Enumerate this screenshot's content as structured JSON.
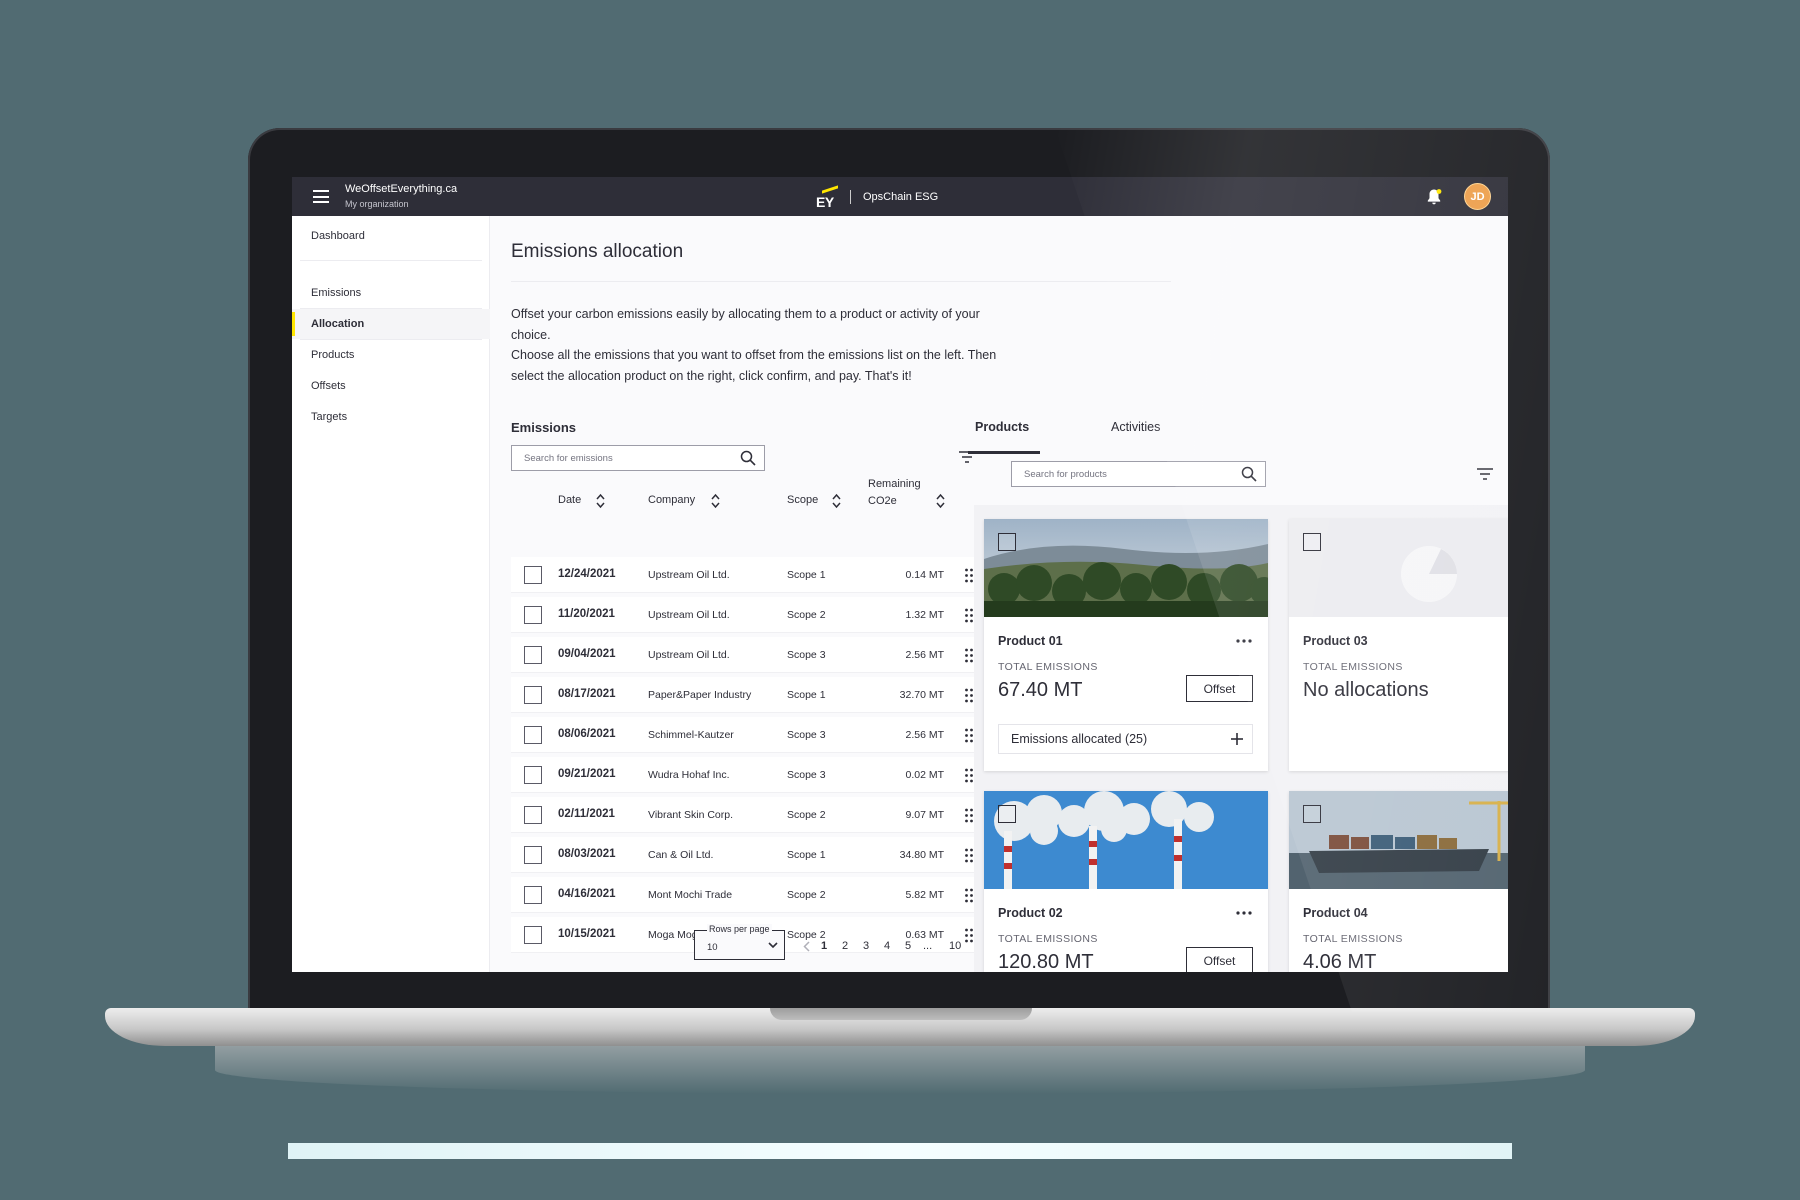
{
  "app": {
    "org_name": "WeOffsetEverything.ca",
    "org_sub": "My organization",
    "brand_logo": "EY",
    "product_name": "OpsChain ESG",
    "avatar_initials": "JD",
    "accent_color": "#ffe600",
    "topbar_color": "#2e2e38"
  },
  "sidebar": {
    "items": [
      {
        "label": "Dashboard",
        "active": false
      },
      {
        "label": "Emissions",
        "active": false
      },
      {
        "label": "Allocation",
        "active": true
      },
      {
        "label": "Products",
        "active": false
      },
      {
        "label": "Offsets",
        "active": false
      },
      {
        "label": "Targets",
        "active": false
      }
    ]
  },
  "page": {
    "title": "Emissions allocation",
    "intro_1": "Offset your carbon emissions easily by allocating them to a product or activity of your choice.",
    "intro_2": "Choose all the emissions that you want to offset from the emissions list on the left. Then select the allocation product on the right, click confirm, and pay. That's it!"
  },
  "emissions": {
    "label": "Emissions",
    "search_placeholder": "Search for emissions",
    "columns": {
      "date": "Date",
      "company": "Company",
      "scope": "Scope",
      "remaining_1": "Remaining",
      "remaining_2": "CO2e"
    },
    "rows": [
      {
        "date": "12/24/2021",
        "company": "Upstream Oil Ltd.",
        "scope": "Scope 1",
        "remaining": "0.14 MT"
      },
      {
        "date": "11/20/2021",
        "company": "Upstream Oil Ltd.",
        "scope": "Scope 2",
        "remaining": "1.32 MT"
      },
      {
        "date": "09/04/2021",
        "company": "Upstream Oil Ltd.",
        "scope": "Scope 3",
        "remaining": "2.56 MT"
      },
      {
        "date": "08/17/2021",
        "company": "Paper&Paper Industry",
        "scope": "Scope 1",
        "remaining": "32.70 MT"
      },
      {
        "date": "08/06/2021",
        "company": "Schimmel-Kautzer",
        "scope": "Scope 3",
        "remaining": "2.56 MT"
      },
      {
        "date": "09/21/2021",
        "company": "Wudra Hohaf Inc.",
        "scope": "Scope 3",
        "remaining": "0.02 MT"
      },
      {
        "date": "02/11/2021",
        "company": "Vibrant Skin Corp.",
        "scope": "Scope 2",
        "remaining": "9.07 MT"
      },
      {
        "date": "08/03/2021",
        "company": "Can & Oil Ltd.",
        "scope": "Scope 1",
        "remaining": "34.80 MT"
      },
      {
        "date": "04/16/2021",
        "company": "Mont Mochi Trade",
        "scope": "Scope 2",
        "remaining": "5.82 MT"
      },
      {
        "date": "10/15/2021",
        "company": "Moga Moga Dishes",
        "scope": "Scope 2",
        "remaining": "0.63 MT"
      }
    ],
    "pagination": {
      "rows_per_page_label": "Rows per page",
      "rows_per_page_value": "10",
      "pages": [
        "1",
        "2",
        "3",
        "4",
        "5",
        "...",
        "10"
      ],
      "current_page": "1"
    }
  },
  "products_panel": {
    "tabs": [
      {
        "label": "Products",
        "active": true
      },
      {
        "label": "Activities",
        "active": false
      }
    ],
    "search_placeholder": "Search for products",
    "cards": [
      {
        "name": "Product 01",
        "emissions_label": "TOTAL EMISSIONS",
        "value": "67.40 MT",
        "offset_label": "Offset",
        "allocated_label": "Emissions allocated (25)",
        "image": "forest"
      },
      {
        "name": "Product 03",
        "emissions_label": "TOTAL EMISSIONS",
        "value": "No allocations",
        "image": "placeholder"
      },
      {
        "name": "Product 02",
        "emissions_label": "TOTAL EMISSIONS",
        "value": "120.80 MT",
        "offset_label": "Offset",
        "image": "smokestacks"
      },
      {
        "name": "Product 04",
        "emissions_label": "TOTAL EMISSIONS",
        "value": "4.06 MT",
        "image": "cargo-ship"
      }
    ]
  }
}
